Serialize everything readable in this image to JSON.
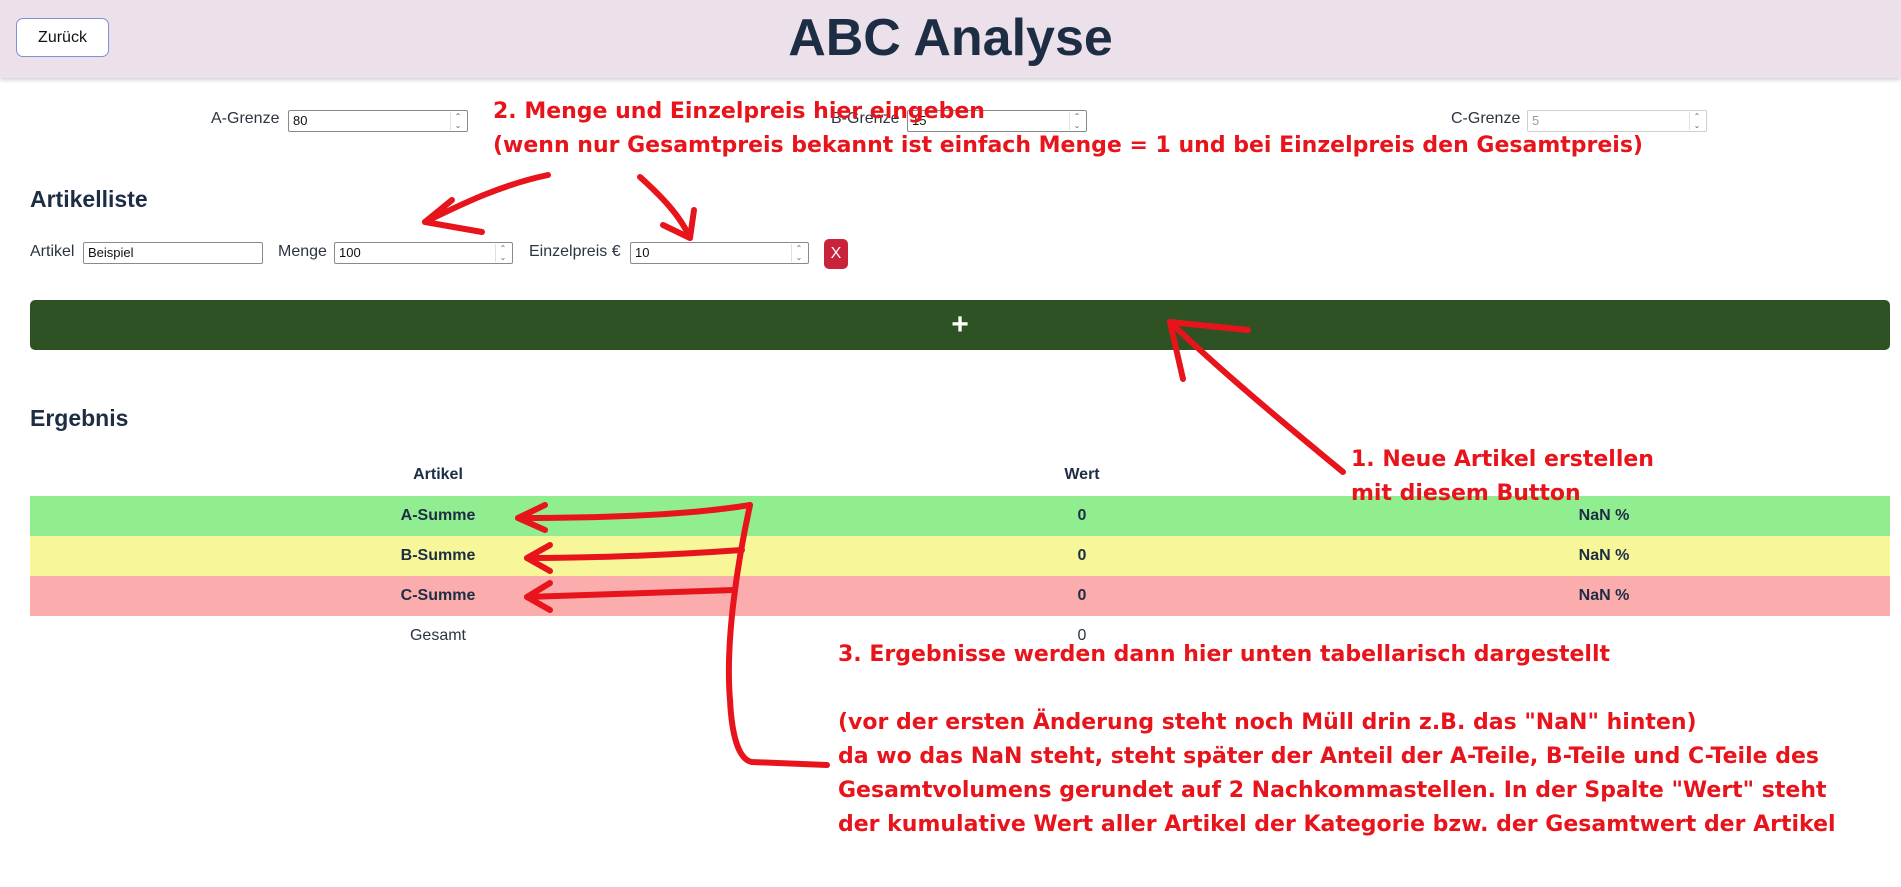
{
  "header": {
    "back_label": "Zurück",
    "title": "ABC Analyse"
  },
  "limits": [
    {
      "label": "A-Grenze",
      "value": "80"
    },
    {
      "label": "B-Grenze",
      "value": "15"
    },
    {
      "label": "C-Grenze",
      "value": "5"
    }
  ],
  "artikelliste": {
    "title": "Artikelliste",
    "artikel_label": "Artikel",
    "artikel_value": "Beispiel",
    "menge_label": "Menge",
    "menge_value": "100",
    "einzelpreis_label": "Einzelpreis €",
    "einzelpreis_value": "10",
    "remove_label": "X",
    "add_label": "+"
  },
  "ergebnis": {
    "title": "Ergebnis",
    "columns": [
      "Artikel",
      "Wert"
    ],
    "rows": [
      {
        "name": "A-Summe",
        "wert": "0",
        "anteil": "NaN %",
        "color": "#90ee90"
      },
      {
        "name": "B-Summe",
        "wert": "0",
        "anteil": "NaN %",
        "color": "#f7f79a"
      },
      {
        "name": "C-Summe",
        "wert": "0",
        "anteil": "NaN %",
        "color": "#fbadad"
      }
    ],
    "total": {
      "name": "Gesamt",
      "wert": "0"
    }
  },
  "annotations": {
    "note1": "1. Neue Artikel erstellen\nmit diesem Button",
    "note2": "2. Menge und Einzelpreis hier eingeben\n(wenn nur Gesamtpreis bekannt ist einfach Menge = 1 und bei Einzelpreis den Gesamtpreis)",
    "note3": "3. Ergebnisse werden dann hier unten tabellarisch dargestellt\n\n(vor der ersten Änderung steht noch Müll drin z.B. das \"NaN\" hinten)\nda wo das NaN steht, steht später der Anteil der A-Teile, B-Teile und C-Teile des\nGesamtvolumens gerundet auf 2 Nachkommastellen. In der Spalte \"Wert\" steht\nder kumulative Wert aller Artikel der Kategorie bzw. der Gesamtwert der Artikel",
    "color": "#e8141c"
  }
}
